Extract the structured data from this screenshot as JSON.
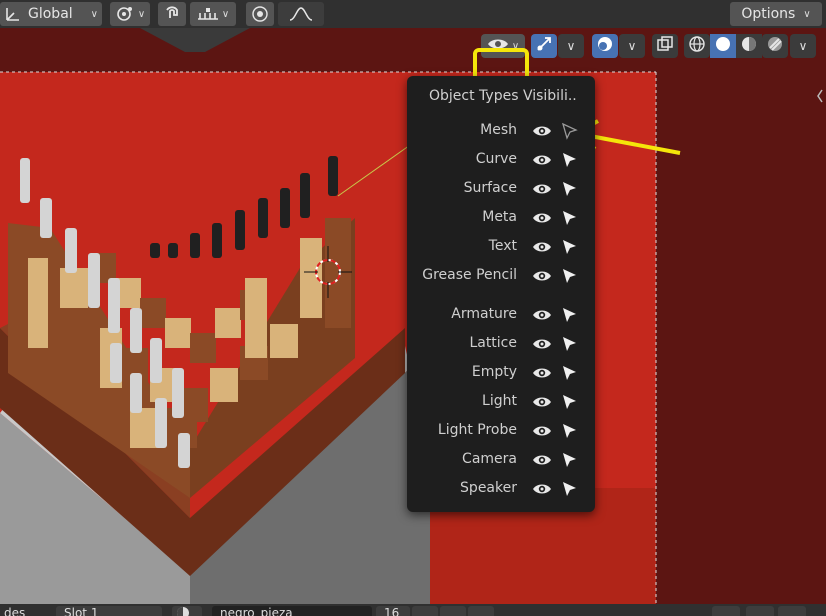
{
  "header": {
    "orientation_label": "Global",
    "options_label": "Options"
  },
  "popover": {
    "title": "Object Types Visibili..",
    "rows": [
      {
        "label": "Mesh",
        "selectable": false
      },
      {
        "label": "Curve",
        "selectable": true
      },
      {
        "label": "Surface",
        "selectable": true
      },
      {
        "label": "Meta",
        "selectable": true
      },
      {
        "label": "Text",
        "selectable": true
      },
      {
        "label": "Grease Pencil",
        "selectable": true
      },
      {
        "label": "Armature",
        "selectable": true
      },
      {
        "label": "Lattice",
        "selectable": true
      },
      {
        "label": "Empty",
        "selectable": true
      },
      {
        "label": "Light",
        "selectable": true
      },
      {
        "label": "Light Probe",
        "selectable": true
      },
      {
        "label": "Camera",
        "selectable": true
      },
      {
        "label": "Speaker",
        "selectable": true
      }
    ]
  },
  "footer": {
    "mode_label": "des",
    "slot_label": "Slot 1",
    "material_name": "negro_pieza",
    "user_count": "16"
  },
  "colors": {
    "annotation": "#f5e60a",
    "accent_blue": "#4772b3",
    "viewport_red": "#c0281c"
  }
}
